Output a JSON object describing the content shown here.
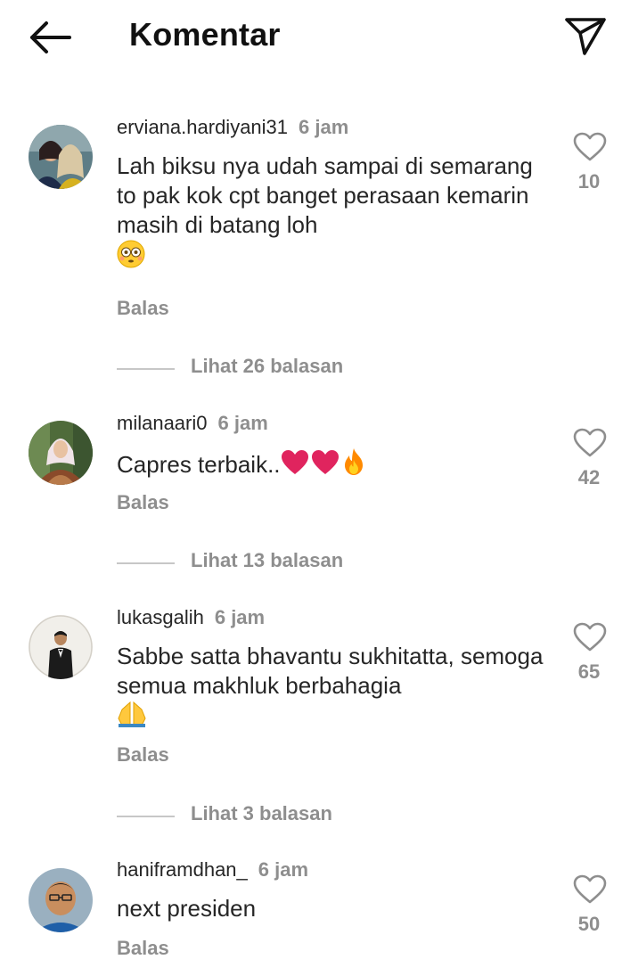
{
  "header": {
    "title": "Komentar"
  },
  "comments": [
    {
      "username": "erviana.hardiyani31",
      "time": "6 jam",
      "text": "Lah biksu nya udah sampai di semarang to pak kok cpt banget perasaan kemarin masih di batang loh",
      "emojis": [
        "flushed-face"
      ],
      "reply_label": "Balas",
      "likes": "10",
      "view_replies": "Lihat 26 balasan"
    },
    {
      "username": "milanaari0",
      "time": "6 jam",
      "text": "Capres terbaik..",
      "emojis": [
        "red-heart",
        "red-heart",
        "fire"
      ],
      "reply_label": "Balas",
      "likes": "42",
      "view_replies": "Lihat 13 balasan"
    },
    {
      "username": "lukasgalih",
      "time": "6 jam",
      "text": "Sabbe satta bhavantu sukhitatta, semoga semua makhluk berbahagia",
      "emojis": [
        "folded-hands"
      ],
      "reply_label": "Balas",
      "likes": "65",
      "view_replies": "Lihat 3 balasan"
    },
    {
      "username": "haniframdhan_",
      "time": "6 jam",
      "text": "next presiden",
      "emojis": [],
      "reply_label": "Balas",
      "likes": "50"
    }
  ],
  "icons": {
    "back": "arrow-left-icon",
    "send": "paper-plane-icon",
    "like": "heart-outline-icon"
  },
  "colors": {
    "text_primary": "#262626",
    "text_secondary": "#8e8e8e",
    "divider": "#c7c7c7",
    "emoji_heart": "#e0245e",
    "emoji_fire": "#ff8a00"
  }
}
